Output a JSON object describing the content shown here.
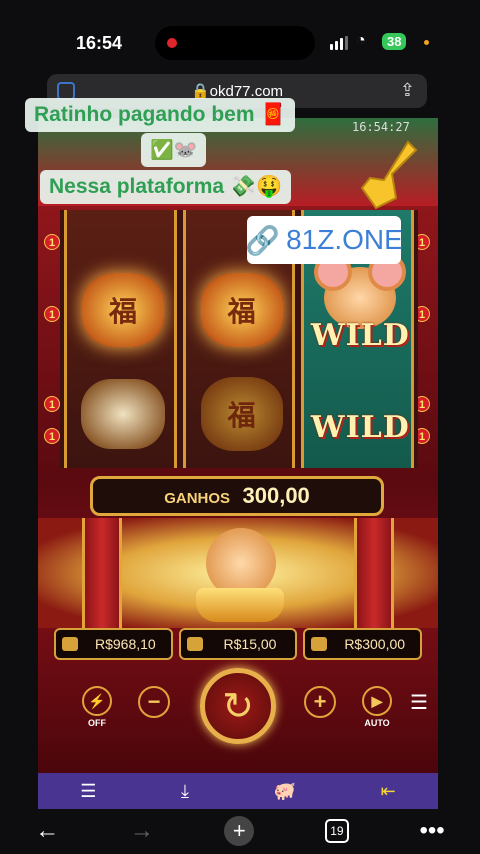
{
  "status_bar": {
    "time": "16:54",
    "battery": "38"
  },
  "browser": {
    "url": "okd77.com",
    "tabs_count": "19"
  },
  "overlays": {
    "caption_1": "Ratinho pagando bem 🧧",
    "caption_1b": "✅🐭",
    "caption_2": "Nessa plataforma 💸🤑",
    "link_text": "81Z.ONE",
    "timestamp": "16:54:27"
  },
  "game": {
    "symbols": {
      "wild": "WILD"
    },
    "payline_label": "1",
    "wins_label": "GANHOS",
    "wins_value": "300,00",
    "balance": "R$968,10",
    "bet": "R$15,00",
    "win_amount": "R$300,00",
    "turbo_label": "OFF",
    "auto_label": "AUTO"
  },
  "colors": {
    "accent_gold": "#e2a43a",
    "overlay_green": "#2f9f54",
    "link_blue": "#3c7fd6",
    "nav_purple": "#4a3491"
  }
}
